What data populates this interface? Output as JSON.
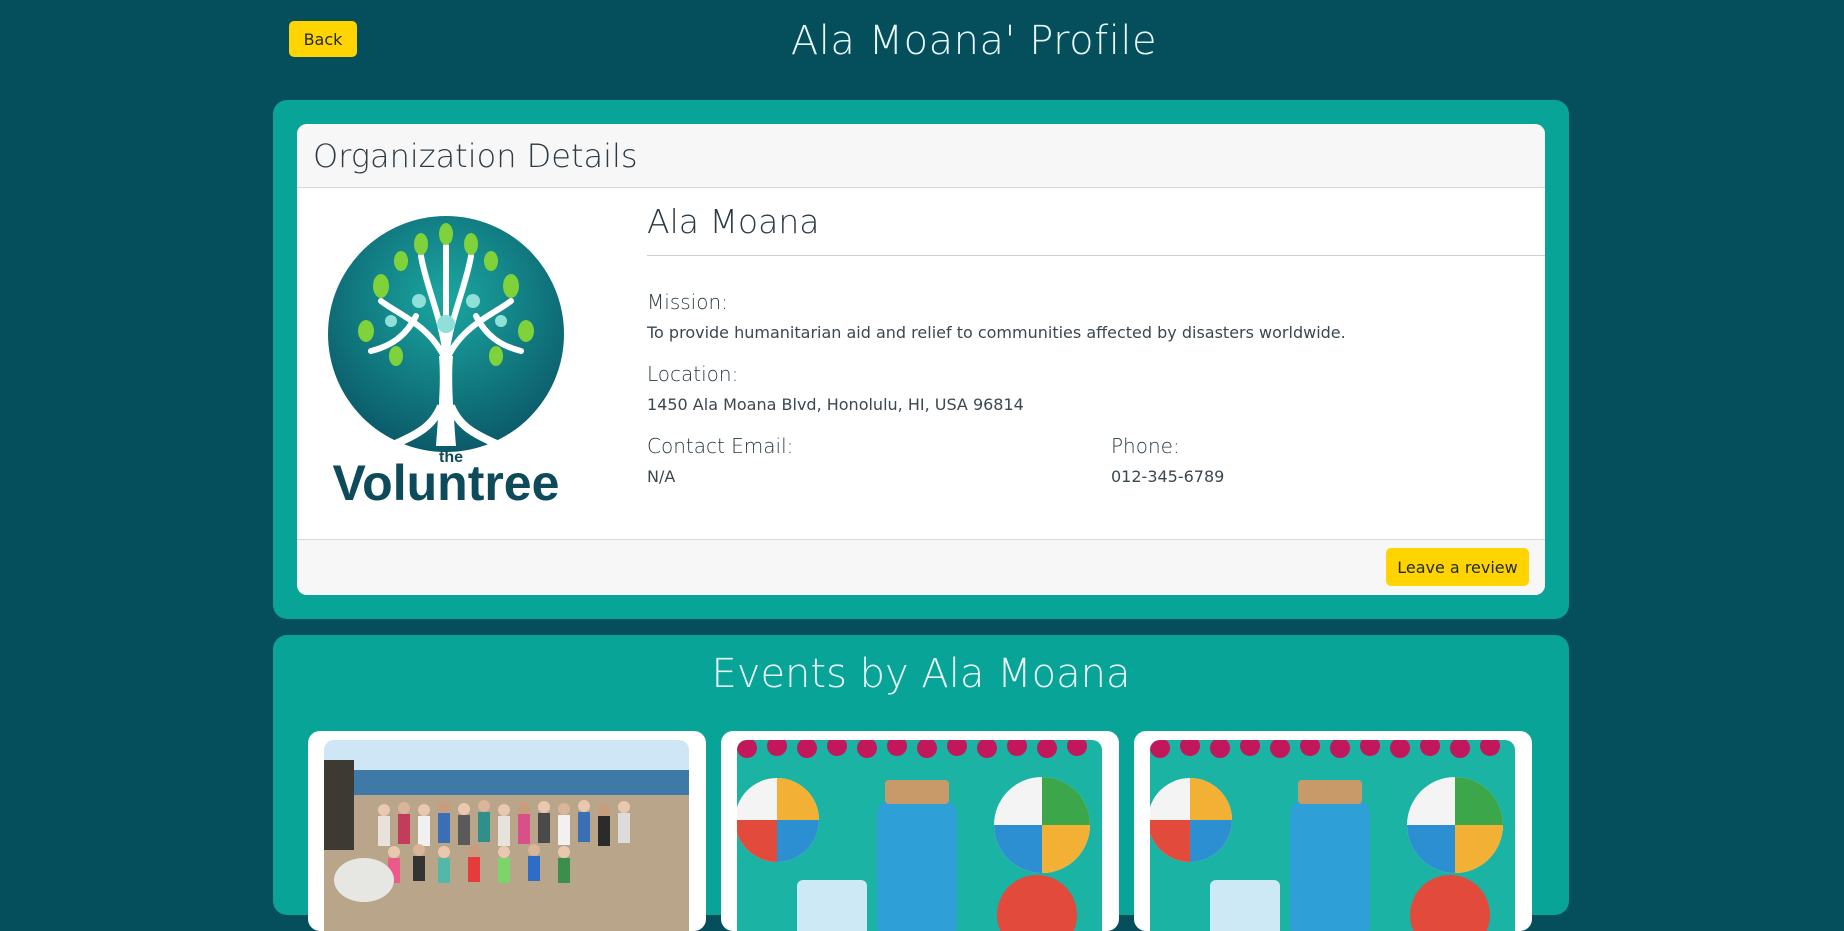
{
  "header": {
    "back_label": "Back",
    "title": "Ala Moana' Profile"
  },
  "org_card": {
    "title": "Organization Details",
    "logo_text_small": "the",
    "logo_text": "Voluntree",
    "name": "Ala Moana",
    "mission_label": "Mission:",
    "mission": "To provide humanitarian aid and relief to communities affected by disasters worldwide.",
    "location_label": "Location:",
    "location": "1450 Ala Moana Blvd, Honolulu, HI, USA 96814",
    "email_label": "Contact Email:",
    "email": "N/A",
    "phone_label": "Phone:",
    "phone": "012-345-6789",
    "review_label": "Leave a review"
  },
  "events": {
    "title": "Events by Ala Moana",
    "cards": [
      {
        "image": "beach-cleanup-group-photo"
      },
      {
        "image": "beach-party-decor-photo"
      },
      {
        "image": "beach-party-decor-photo"
      }
    ]
  },
  "colors": {
    "background": "#044f5b",
    "panel": "#07a497",
    "button": "#ffd400"
  }
}
